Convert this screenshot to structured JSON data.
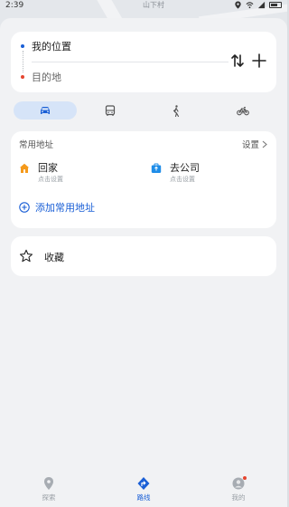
{
  "status_bar": {
    "time": "2:39"
  },
  "map": {
    "label": "山下村"
  },
  "route": {
    "from": "我的位置",
    "to": "目的地"
  },
  "transport_modes": [
    "car",
    "bus",
    "walk",
    "bike"
  ],
  "frequent": {
    "title": "常用地址",
    "settings": "设置",
    "home": {
      "name": "回家",
      "sub": "点击设置"
    },
    "work": {
      "name": "去公司",
      "sub": "点击设置"
    },
    "add_label": "添加常用地址"
  },
  "favorites": {
    "label": "收藏"
  },
  "nav": {
    "explore": "探索",
    "route": "路线",
    "mine": "我的"
  },
  "colors": {
    "accent": "#1a5fd6",
    "home_icon": "#f59a1b",
    "work_icon": "#1f8de8",
    "badge": "#e5452f"
  }
}
